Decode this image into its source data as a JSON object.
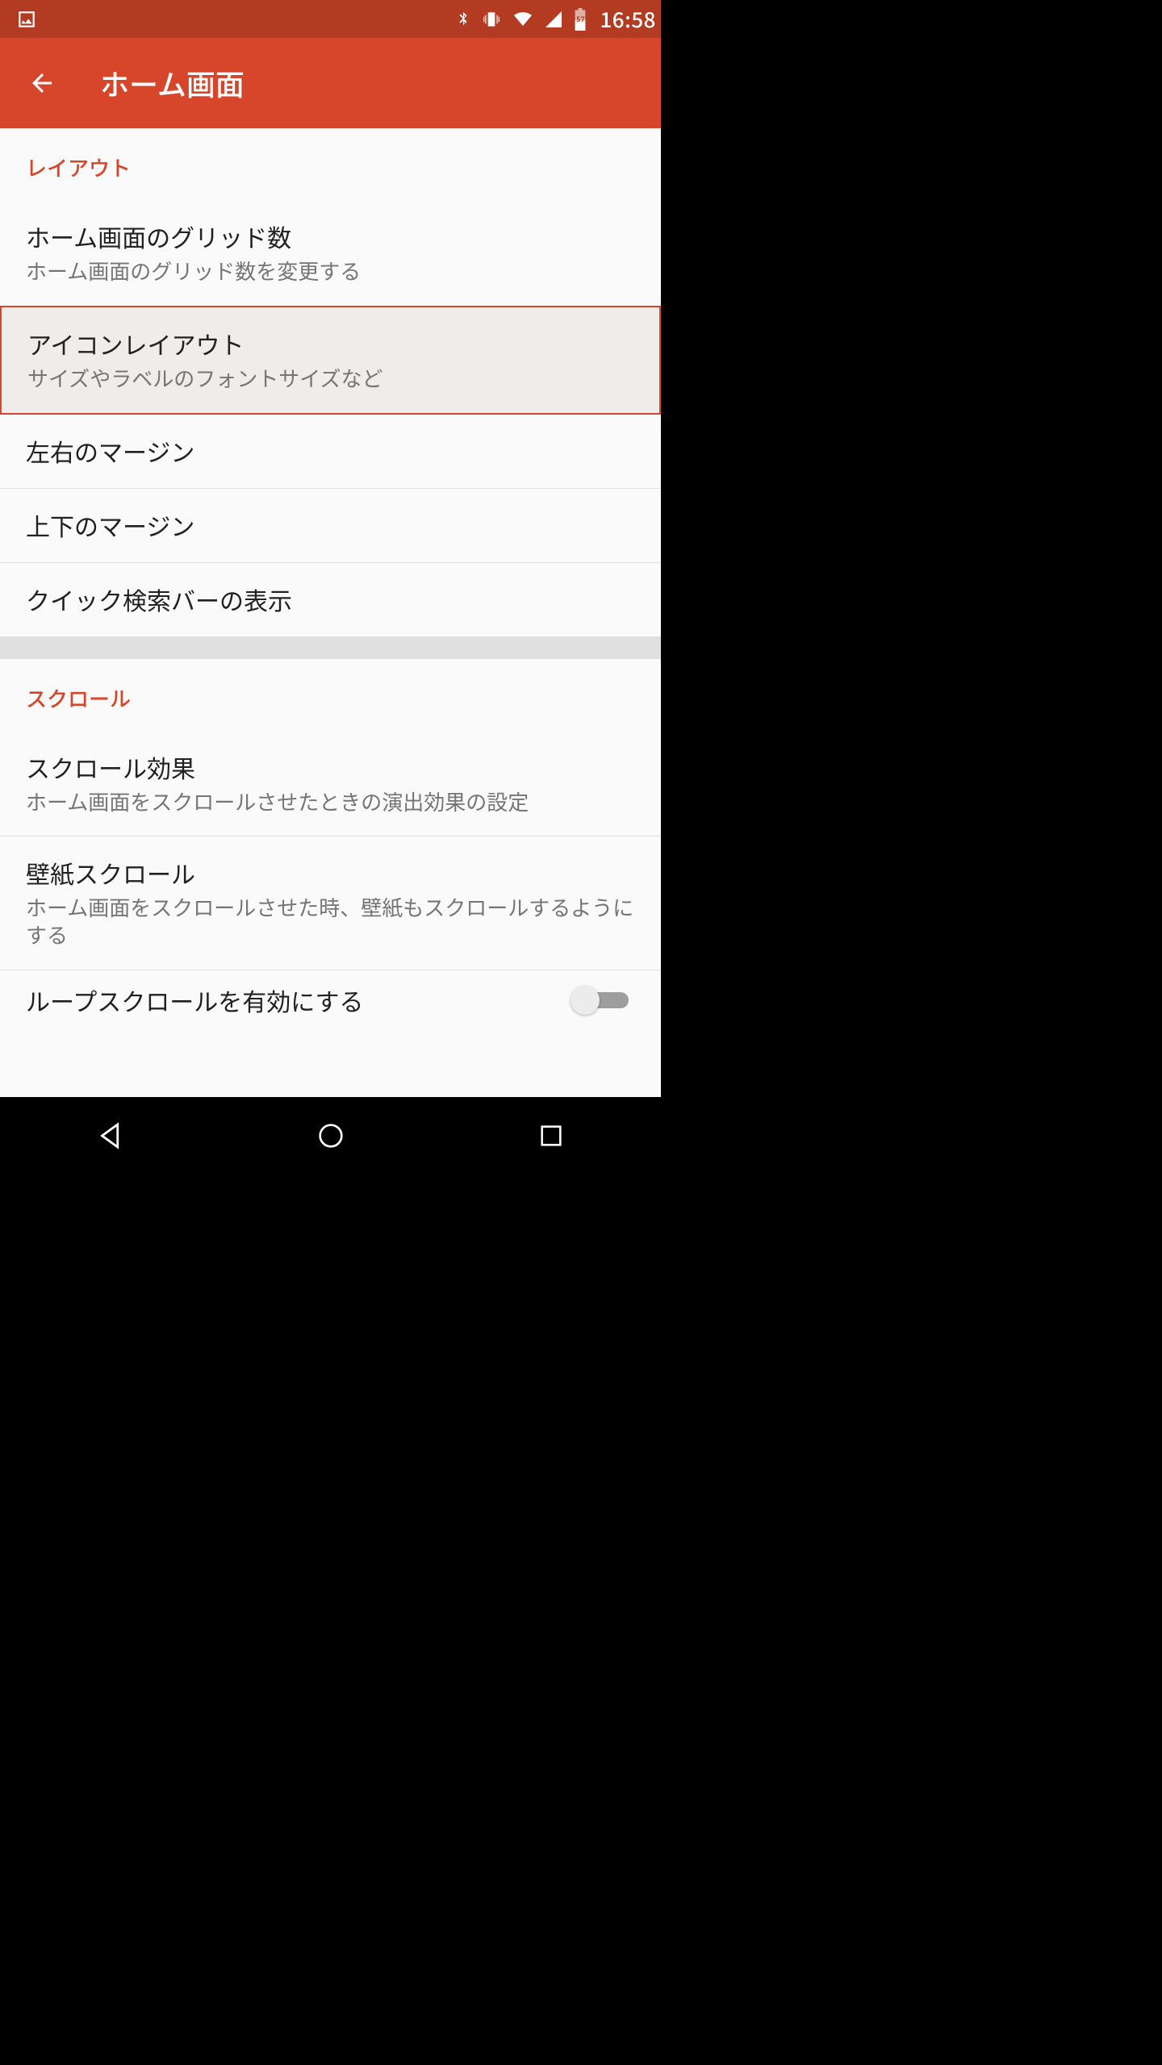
{
  "status": {
    "time": "16:58",
    "battery_badge": "57"
  },
  "appbar": {
    "title": "ホーム画面"
  },
  "sections": {
    "layout": {
      "header": "レイアウト",
      "items": {
        "grid": {
          "title": "ホーム画面のグリッド数",
          "sub": "ホーム画面のグリッド数を変更する"
        },
        "iconlayout": {
          "title": "アイコンレイアウト",
          "sub": "サイズやラベルのフォントサイズなど"
        },
        "hmargin": {
          "title": "左右のマージン"
        },
        "vmargin": {
          "title": "上下のマージン"
        },
        "qsearch": {
          "title": "クイック検索バーの表示"
        }
      }
    },
    "scroll": {
      "header": "スクロール",
      "items": {
        "effect": {
          "title": "スクロール効果",
          "sub": "ホーム画面をスクロールさせたときの演出効果の設定"
        },
        "wallpaper": {
          "title": "壁紙スクロール",
          "sub": "ホーム画面をスクロールさせた時、壁紙もスクロールするようにする"
        },
        "loop": {
          "title": "ループスクロールを有効にする",
          "enabled": false
        }
      }
    }
  }
}
